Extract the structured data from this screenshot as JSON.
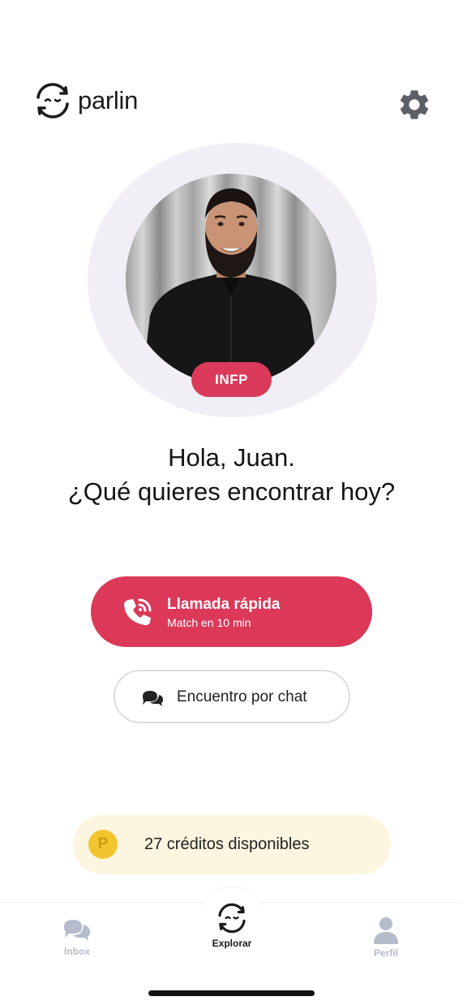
{
  "app": {
    "name": "parlin"
  },
  "header": {
    "settings_icon": "gear-icon"
  },
  "profile": {
    "personality_badge": "INFP"
  },
  "greeting": {
    "line1": "Hola, Juan.",
    "line2": "¿Qué quieres encontrar hoy?"
  },
  "actions": {
    "quick_call": {
      "title": "Llamada rápida",
      "subtitle": "Match en 10 min",
      "icon": "phone-call-icon"
    },
    "chat_match": {
      "label": "Encuentro por chat",
      "icon": "chat-bubbles-icon"
    }
  },
  "credits": {
    "coin_symbol": "P",
    "label": "27 créditos disponibles"
  },
  "nav": {
    "items": [
      {
        "label": "Inbox",
        "icon": "chat-bubbles-icon",
        "active": false
      },
      {
        "label": "Explorar",
        "icon": "parlin-logo-icon",
        "active": true
      },
      {
        "label": "Perfil",
        "icon": "person-icon",
        "active": false
      }
    ]
  },
  "colors": {
    "accent": "#DC3858",
    "blob": "#F1EFF5",
    "credits_bg": "#FCF6E0",
    "coin": "#F2C52F",
    "nav_inactive": "#B4BCCC"
  }
}
